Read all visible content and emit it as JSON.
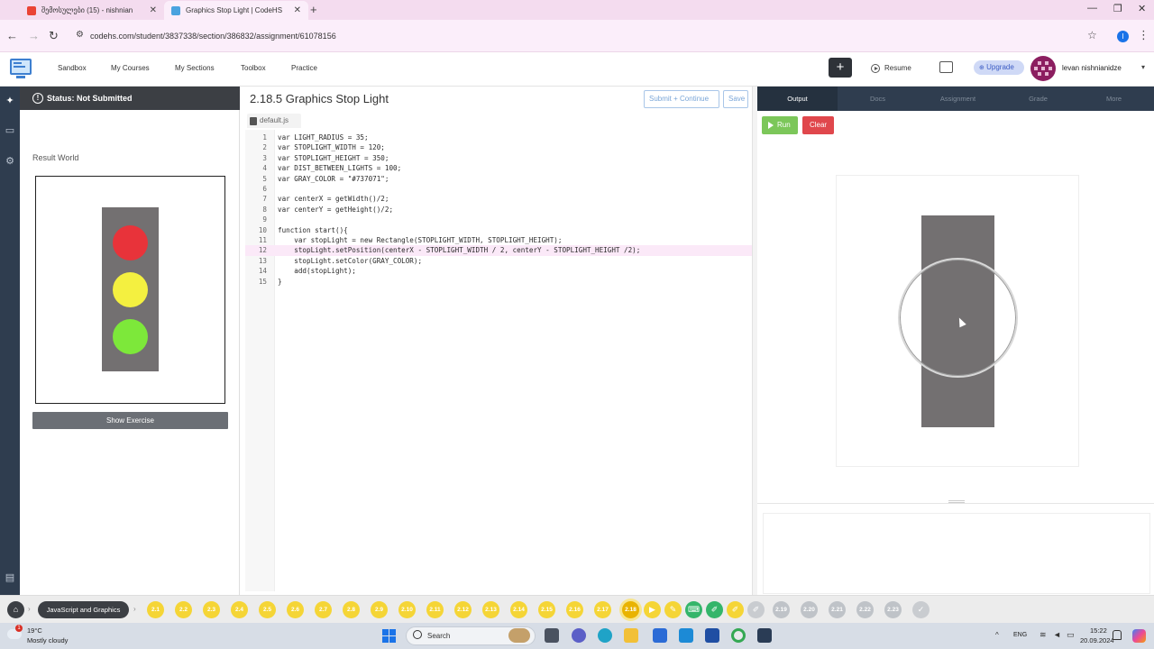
{
  "browser": {
    "tabs": [
      {
        "title": "შემოსულები (15) - nishnian",
        "active": false
      },
      {
        "title": "Graphics Stop Light | CodeHS",
        "active": true
      }
    ],
    "url": "codehs.com/student/3837338/section/386832/assignment/61078156",
    "profile_initial": "I"
  },
  "app": {
    "nav": [
      "Sandbox",
      "My Courses",
      "My Sections",
      "Toolbox",
      "Practice"
    ],
    "resume_label": "Resume",
    "upgrade_label": "Upgrade",
    "username": "levan nishnianidze"
  },
  "left_panel": {
    "status": "Status: Not Submitted",
    "result_label": "Result World",
    "show_exercise_label": "Show Exercise",
    "light_colors": [
      "#e8333a",
      "#f4f040",
      "#7de83a"
    ],
    "body_color": "#737071"
  },
  "editor": {
    "title": "2.18.5 Graphics Stop Light",
    "submit_label": "Submit + Continue",
    "save_label": "Save",
    "filename": "default.js",
    "active_line": 12,
    "lines": [
      "var LIGHT_RADIUS = 35;",
      "var STOPLIGHT_WIDTH = 120;",
      "var STOPLIGHT_HEIGHT = 350;",
      "var DIST_BETWEEN_LIGHTS = 100;",
      "var GRAY_COLOR = \"#737071\";",
      "",
      "var centerX = getWidth()/2;",
      "var centerY = getHeight()/2;",
      "",
      "function start(){",
      "    var stopLight = new Rectangle(STOPLIGHT_WIDTH, STOPLIGHT_HEIGHT);",
      "    stopLight.setPosition(centerX - STOPLIGHT_WIDTH / 2, centerY - STOPLIGHT_HEIGHT /2);",
      "    stopLight.setColor(GRAY_COLOR);",
      "    add(stopLight);",
      "}"
    ]
  },
  "output": {
    "tabs": [
      "Output",
      "Docs",
      "Assignment",
      "Grade",
      "More"
    ],
    "run_label": "Run",
    "clear_label": "Clear"
  },
  "lesson_bar": {
    "unit": "JavaScript and Graphics",
    "items": [
      "2.1",
      "2.2",
      "2.3",
      "2.4",
      "2.5",
      "2.6",
      "2.7",
      "2.8",
      "2.9",
      "2.10",
      "2.11",
      "2.12",
      "2.13",
      "2.14",
      "2.15",
      "2.16",
      "2.17",
      "2.18"
    ],
    "current": "2.18",
    "later_items": [
      "2.19",
      "2.20",
      "2.21",
      "2.22",
      "2.23"
    ]
  },
  "taskbar": {
    "weather_temp": "19°C",
    "weather_desc": "Mostly cloudy",
    "weather_badge": "1",
    "search_label": "Search",
    "lang": "ENG",
    "time": "15:22",
    "date": "20.09.2024"
  }
}
